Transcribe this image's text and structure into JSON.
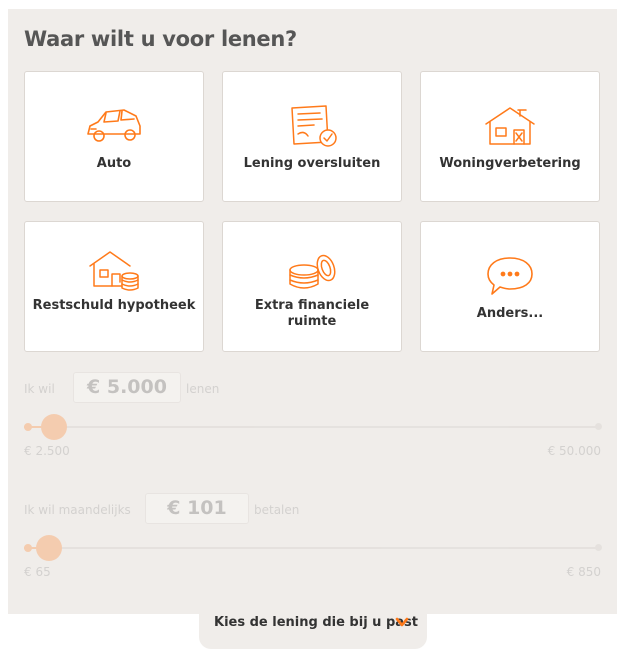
{
  "heading": "Waar wilt u voor lenen?",
  "options": [
    {
      "label": "Auto",
      "icon": "car-icon"
    },
    {
      "label": "Lening oversluiten",
      "icon": "contract-check-icon"
    },
    {
      "label": "Woningverbetering",
      "icon": "house-repair-icon"
    },
    {
      "label": "Restschuld hypotheek",
      "icon": "house-coins-icon"
    },
    {
      "label": "Extra financiele ruimte",
      "icon": "coins-stack-icon"
    },
    {
      "label": "Anders...",
      "icon": "speech-bubble-icon"
    }
  ],
  "loan": {
    "prefix": "Ik wil",
    "amount": "€ 5.000",
    "suffix": "lenen",
    "min": "€ 2.500",
    "max": "€ 50.000",
    "position": 0.055
  },
  "monthly": {
    "prefix": "Ik wil maandelijks",
    "amount": "€ 101",
    "suffix": "betalen",
    "min": "€ 65",
    "max": "€ 850",
    "position": 0.045
  },
  "cta": {
    "label": "Kies de lening die bij u past",
    "icon": "chevron-down-icon"
  },
  "colors": {
    "accent": "#ff7a1a",
    "panel": "#f0edea"
  }
}
